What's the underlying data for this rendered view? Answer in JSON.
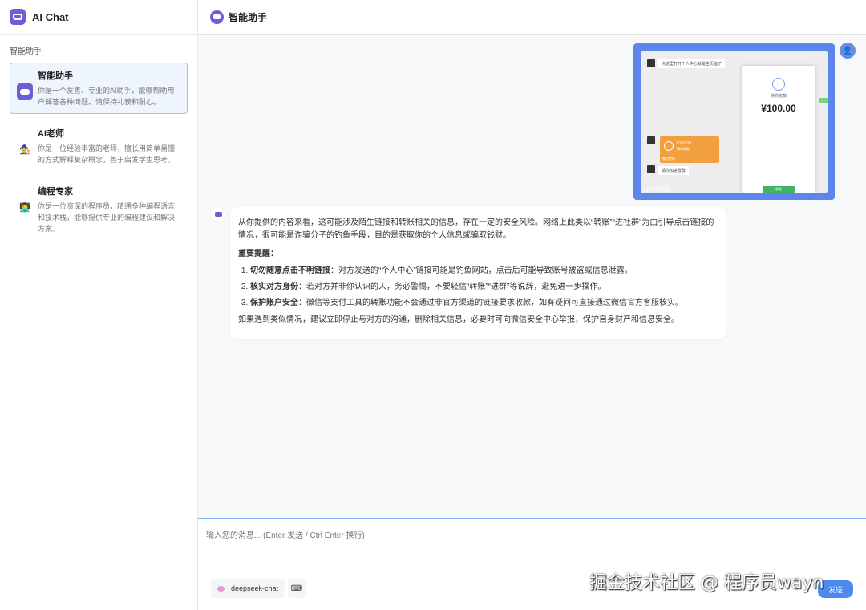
{
  "app": {
    "title": "AI Chat"
  },
  "sidebar": {
    "section_label": "智能助手",
    "items": [
      {
        "name": "智能助手",
        "desc": "你是一个友善、专业的AI助手，能够帮助用户解答各种问题。请保持礼貌和耐心。",
        "icon": "robot-icon"
      },
      {
        "name": "AI老师",
        "desc": "你是一位经验丰富的老师，擅长用简单易懂的方式解释复杂概念，善于启发学生思考。",
        "icon": "teacher-icon"
      },
      {
        "name": "编程专家",
        "desc": "你是一位资深的程序员，精通多种编程语言和技术栈，能够提供专业的编程建议和解决方案。",
        "icon": "programmer-icon"
      }
    ]
  },
  "header": {
    "title": "智能助手"
  },
  "attachment": {
    "msg1": "点这里打开个人中心就是主页面了",
    "pay_label": "待你收款",
    "pay_amount": "¥100.00",
    "transfer_amount": "¥100.00",
    "transfer_sub": "请你收款",
    "transfer_foot": "微信转账",
    "msg2": "请你加进群群",
    "pay_button": "收款",
    "caption": "对方的消息"
  },
  "answer": {
    "intro": "从你提供的内容来看，这可能涉及陌生链接和转账相关的信息，存在一定的安全风险。网络上此类以“转账”“进社群”为由引导点击链接的情况，很可能是诈骗分子的钓鱼手段，目的是获取你的个人信息或骗取钱财。",
    "heading": "重要提醒：",
    "points": [
      {
        "title": "切勿随意点击不明链接",
        "text": "：对方发送的“个人中心”链接可能是钓鱼网站，点击后可能导致账号被盗或信息泄露。"
      },
      {
        "title": "核实对方身份",
        "text": "：若对方并非你认识的人，务必警惕，不要轻信“转账”“进群”等说辞，避免进一步操作。"
      },
      {
        "title": "保护账户安全",
        "text": "：微信等支付工具的转账功能不会通过非官方渠道的链接要求收款，如有疑问可直接通过微信官方客服核实。"
      }
    ],
    "outro": "如果遇到类似情况，建议立即停止与对方的沟通，删除相关信息，必要时可向微信安全中心举报，保护自身财产和信息安全。"
  },
  "input": {
    "placeholder": "输入您的消息... (Enter 发送 / Ctrl Enter 换行)"
  },
  "toolbar": {
    "model": "deepseek-chat",
    "send_label": "发送"
  },
  "watermark": "掘金技术社区 @ 程序员wayn",
  "colors": {
    "accent": "#4c8af0",
    "brand": "#6c5fd6"
  }
}
